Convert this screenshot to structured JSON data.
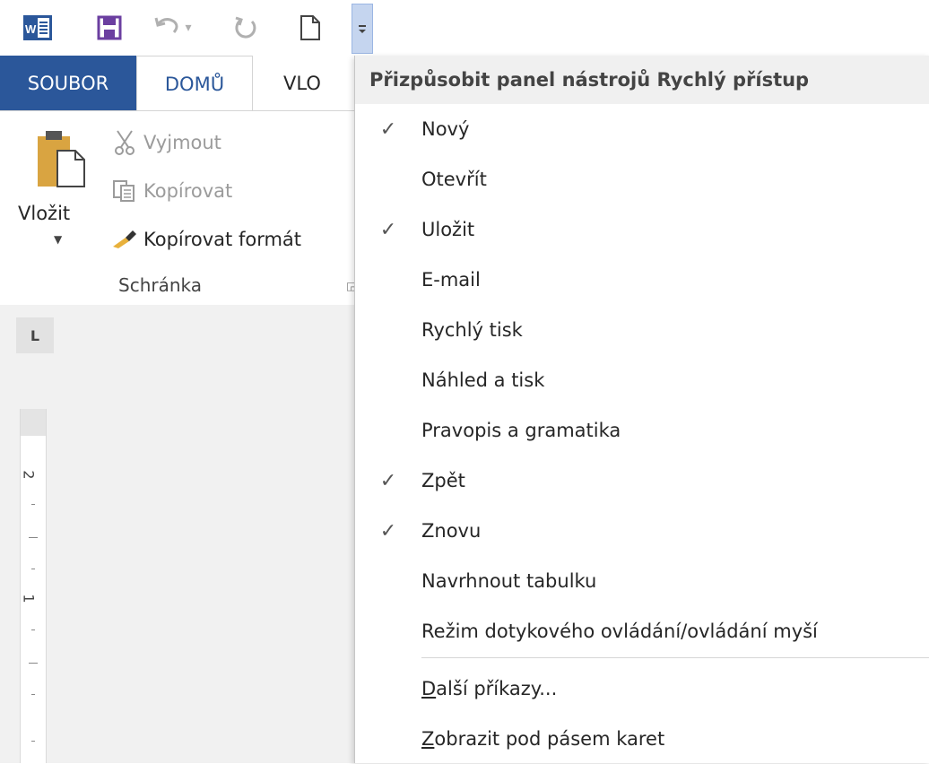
{
  "qat": {
    "buttons": [
      "word-app-icon",
      "save-icon",
      "undo-icon",
      "redo-icon",
      "new-document-icon",
      "customize-qat-icon"
    ],
    "undo_dropdown": "▾"
  },
  "tabs": {
    "file": "SOUBOR",
    "home": "DOMŮ",
    "insert": "VLO"
  },
  "ribbon": {
    "paste_label": "Vložit",
    "cut_label": "Vyjmout",
    "copy_label": "Kopírovat",
    "format_painter_label": "Kopírovat formát",
    "group_label": "Schránka"
  },
  "ruler": {
    "tab_selector": "L",
    "num2": "2",
    "num1": "1"
  },
  "menu": {
    "header": "Přizpůsobit panel nástrojů Rychlý přístup",
    "items": [
      {
        "label": "Nový",
        "checked": true
      },
      {
        "label": "Otevřít",
        "checked": false
      },
      {
        "label": "Uložit",
        "checked": true
      },
      {
        "label": "E-mail",
        "checked": false
      },
      {
        "label": "Rychlý tisk",
        "checked": false
      },
      {
        "label": "Náhled a tisk",
        "checked": false
      },
      {
        "label": "Pravopis a gramatika",
        "checked": false
      },
      {
        "label": "Zpět",
        "checked": true
      },
      {
        "label": "Znovu",
        "checked": true
      },
      {
        "label": "Navrhnout tabulku",
        "checked": false
      },
      {
        "label": "Režim dotykového ovládání/ovládání myší",
        "checked": false
      }
    ],
    "more_commands_first": "D",
    "more_commands_rest": "alší příkazy...",
    "show_below_first": "Z",
    "show_below_rest": "obrazit pod pásem karet",
    "check_glyph": "✓"
  },
  "colors": {
    "word_blue": "#2b579a",
    "save_purple": "#6b3fa0",
    "header_bg": "#f0f0f0"
  }
}
